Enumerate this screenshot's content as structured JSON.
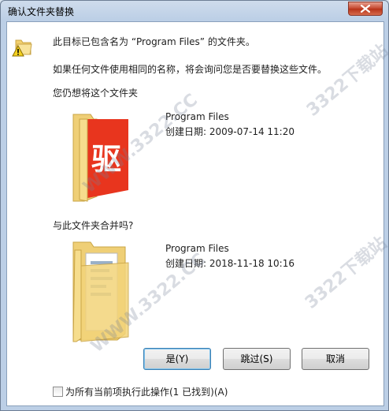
{
  "window": {
    "title": "确认文件夹替换"
  },
  "dialog": {
    "message1": "此目标已包含名为 “Program Files” 的文件夹。",
    "message2": "如果任何文件使用相同的名称，将会询问您是否要替换这些文件。",
    "question1": "您仍想将这个文件夹",
    "question2": "与此文件夹合并吗?"
  },
  "source_folder": {
    "name": "Program Files",
    "created": "创建日期: 2009-07-14 11:20",
    "badge_text": "驱"
  },
  "target_folder": {
    "name": "Program Files",
    "created": "创建日期: 2018-11-18 10:16"
  },
  "buttons": {
    "yes": "是(Y)",
    "skip": "跳过(S)",
    "cancel": "取消"
  },
  "checkbox_label": "为所有当前项执行此操作(1 已找到)(A)",
  "watermarks": [
    "WWW.3322.CC",
    "3322下载站",
    "WWW.3322.CC",
    "3322下载站"
  ],
  "colors": {
    "badge_red": "#e8351e",
    "folder_yellow": "#f3d47a"
  }
}
